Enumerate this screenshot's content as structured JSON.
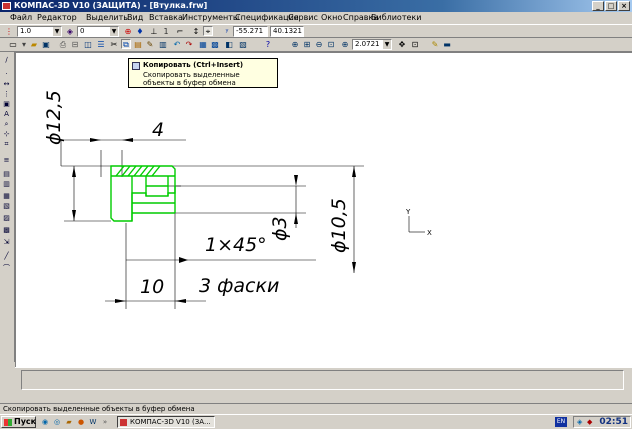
{
  "window": {
    "title": "КОМПАС-3D V10 (ЗАЩИТА) - [Втулка.frw]",
    "controls": [
      "_",
      "□",
      "×"
    ]
  },
  "menu": [
    "Файл",
    "Редактор",
    "Выделить",
    "Вид",
    "Вставка",
    "Инструменты",
    "Спецификация",
    "Сервис",
    "Окно",
    "Справка",
    "Библиотеки"
  ],
  "toolbar1": {
    "scale_value": "1.0",
    "layer_value": "0",
    "coord_x": "-55.271",
    "coord_y": "40.1321"
  },
  "toolbar2": {
    "zoom_value": "2.0721"
  },
  "tooltip": {
    "title": "Копировать (Ctrl+Insert)",
    "text": "Скопировать выделенные объекты в буфер обмена"
  },
  "drawing": {
    "dim_diameter_outer": "ϕ12,5",
    "dim_width": "4",
    "dim_diameter_right": "ϕ10,5",
    "dim_diameter_hole": "ϕ3",
    "chamfer": "1×45°",
    "dim_length": "10",
    "chamfer_count": "3 фаски",
    "axis_y": "Y",
    "axis_x": "X"
  },
  "status_text": "Скопировать выделенные объекты в буфер обмена",
  "taskbar": {
    "start_label": "Пуск",
    "task_label": "КОМПАС-3D V10 (ЗА...",
    "lang": "EN",
    "clock": "02:51"
  },
  "colors": {
    "selection_green": "#00cc00",
    "titlebar": "#0a246a",
    "tooltip_bg": "#ffffe1"
  }
}
